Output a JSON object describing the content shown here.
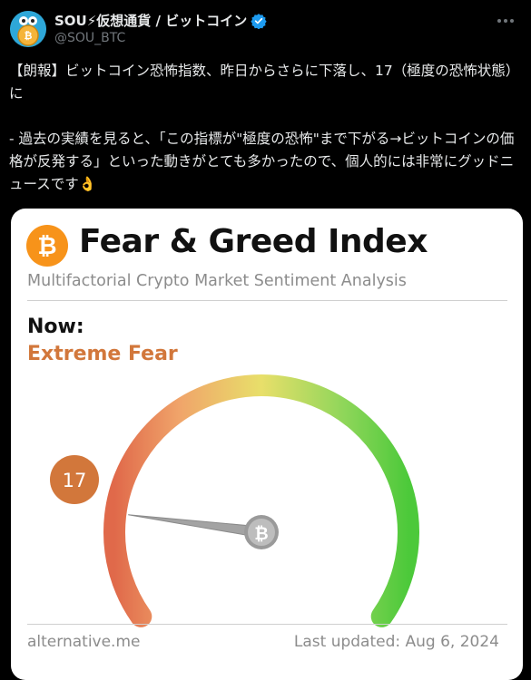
{
  "tweet": {
    "display_name": "SOU⚡仮想通貨 / ビットコイン",
    "handle": "@SOU_BTC",
    "paragraphs": [
      "【朗報】ビットコイン恐怖指数、昨日からさらに下落し、17（極度の恐怖状態）に",
      "- 過去の実績を見ると、「この指標が\"極度の恐怖\"まで下がる→ビットコインの価格が反発する」といった動きがとても多かったので、個人的には非常にグッドニュースです👌"
    ]
  },
  "card": {
    "title": "Fear & Greed Index",
    "subtitle": "Multifactorial Crypto Market Sentiment Analysis",
    "now_label": "Now:",
    "now_value": "Extreme Fear",
    "footer_source": "alternative.me",
    "footer_updated": "Last updated: Aug 6, 2024"
  },
  "gauge": {
    "value": 17,
    "value_label": "17",
    "min": 0,
    "max": 100,
    "value_color": "#d2773b",
    "gradient": [
      "#e0694a",
      "#f0a46a",
      "#e8df6a",
      "#8fd65a",
      "#4cc93a"
    ]
  },
  "colors": {
    "accent_bitcoin": "#f7931a",
    "verified": "#1d9bf0"
  }
}
